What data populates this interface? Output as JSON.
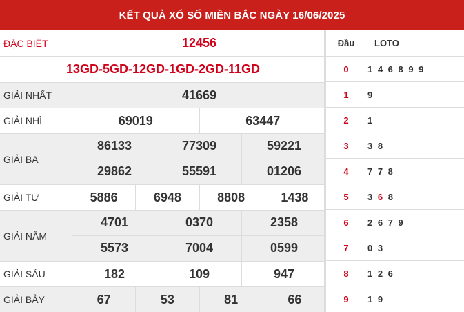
{
  "header": {
    "title": "KẾT QUẢ XỔ SỐ MIỀN BẮC NGÀY 16/06/2025"
  },
  "results": {
    "dac_biet": {
      "label": "ĐẶC BIỆT",
      "value": "12456"
    },
    "ma_db": "13GD-5GD-12GD-1GD-2GD-11GD",
    "nhat": {
      "label": "GIẢI NHẤT",
      "values": [
        "41669"
      ]
    },
    "nhi": {
      "label": "GIẢI NHÌ",
      "values": [
        "69019",
        "63447"
      ]
    },
    "ba": {
      "label": "GIẢI BA",
      "values": [
        "86133",
        "77309",
        "59221",
        "29862",
        "55591",
        "01206"
      ]
    },
    "tu": {
      "label": "GIẢI TƯ",
      "values": [
        "5886",
        "6948",
        "8808",
        "1438"
      ]
    },
    "nam": {
      "label": "GIẢI NĂM",
      "values": [
        "4701",
        "0370",
        "2358",
        "5573",
        "7004",
        "0599"
      ]
    },
    "sau": {
      "label": "GIẢI SÁU",
      "values": [
        "182",
        "109",
        "947"
      ]
    },
    "bay": {
      "label": "GIẢI BẢY",
      "values": [
        "67",
        "53",
        "81",
        "66"
      ]
    }
  },
  "loto": {
    "head_dau": "Đầu",
    "head_loto": "LOTO",
    "rows": [
      {
        "dau": "0",
        "loto": "1 4 6 8 9 9"
      },
      {
        "dau": "1",
        "loto": "9"
      },
      {
        "dau": "2",
        "loto": "1"
      },
      {
        "dau": "3",
        "loto": "3 8"
      },
      {
        "dau": "4",
        "loto": "7 7 8"
      },
      {
        "dau": "5",
        "loto_pre": "3 ",
        "loto_hl": "6",
        "loto_post": " 8"
      },
      {
        "dau": "6",
        "loto": "2 6 7 9"
      },
      {
        "dau": "7",
        "loto": "0 3"
      },
      {
        "dau": "8",
        "loto": "1 2 6"
      },
      {
        "dau": "9",
        "loto": "1 9"
      }
    ]
  },
  "colors": {
    "header_bg": "#c9201c",
    "accent_red": "#d0021b",
    "row_gray": "#eeeeee"
  }
}
